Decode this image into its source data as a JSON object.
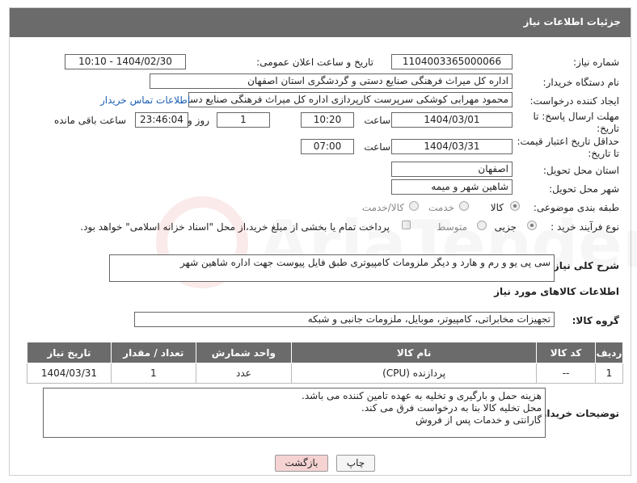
{
  "header": {
    "title": "جزئیات اطلاعات نیاز"
  },
  "form": {
    "need_number_label": "شماره نیاز:",
    "need_number": "1104003365000066",
    "announce_label": "تاریخ و ساعت اعلان عمومی:",
    "announce_value": "1404/02/30 - 10:10",
    "buyer_org_label": "نام دستگاه خریدار:",
    "buyer_org": "اداره کل میراث فرهنگی  صنایع دستی و گردشگری استان اصفهان",
    "requester_label": "ایجاد کننده درخواست:",
    "requester": "محمود مهرابی کوشکی سرپرست کارپردازی اداره کل میراث فرهنگی  صنایع دستی و گردشگری استان اصفهان",
    "contact_link": "اطلاعات تماس خریدار",
    "deadline_label_1": "مهلت ارسال پاسخ: تا",
    "deadline_label_2": "تاریخ:",
    "deadline_date": "1404/03/01",
    "time_label": "ساعت",
    "deadline_time": "10:20",
    "days_value": "1",
    "days_label": "روز و",
    "remaining_time": "23:46:04",
    "remaining_label": "ساعت باقی مانده",
    "min_validity_label_1": "حداقل تاریخ اعتبار قیمت:",
    "min_validity_label_2": "تا تاریخ:",
    "validity_date": "1404/03/31",
    "validity_time": "07:00",
    "province_label": "استان محل تحویل:",
    "province": "اصفهان",
    "city_label": "شهر محل تحویل:",
    "city": "شاهین شهر و میمه",
    "category_label": "طبقه بندی موضوعی:",
    "category_options": [
      "کالا",
      "خدمت",
      "کالا/خدمت"
    ],
    "process_label": "نوع فرآیند خرید :",
    "process_options": [
      "جزیی",
      "متوسط"
    ],
    "payment_note": "پرداخت تمام یا بخشی از مبلغ خرید،از محل \"اسناد خزانه اسلامی\" خواهد بود."
  },
  "description": {
    "label": "شرح کلی نیاز:",
    "text": "سی پی یو و رم و هارد و دیگر ملزومات کامپیوتری طبق فایل پیوست جهت اداره شاهین شهر"
  },
  "goods_section": {
    "title": "اطلاعات کالاهای مورد نیاز",
    "group_label": "گروه کالا:",
    "group_value": "تجهیزات مخابراتی، کامپیوتر، موبایل، ملزومات جانبی و شبکه"
  },
  "table": {
    "headers": [
      "ردیف",
      "کد کالا",
      "نام کالا",
      "واحد شمارش",
      "تعداد / مقدار",
      "تاریخ نیاز"
    ],
    "rows": [
      [
        "1",
        "--",
        "پردازنده (CPU)",
        "عدد",
        "1",
        "1404/03/31"
      ]
    ]
  },
  "buyer_notes": {
    "label": "توضیحات خریدار:",
    "lines": [
      "هزینه حمل و بارگیری و تخلیه به عهده تامین کننده می باشد.",
      "محل تخلیه کالا بنا به درخواست فرق می کند.",
      "گارانتی و خدمات پس از فروش"
    ]
  },
  "buttons": {
    "print": "چاپ",
    "back": "بازگشت"
  },
  "colors": {
    "header_bg": "#6b6b6b",
    "link": "#1a5fb4",
    "back_btn": "#f6d3d3"
  }
}
